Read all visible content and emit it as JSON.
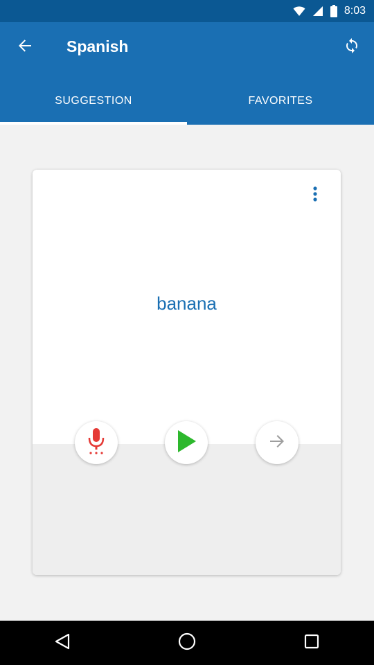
{
  "status_bar": {
    "time": "8:03"
  },
  "app_bar": {
    "title": "Spanish",
    "back_icon": "arrow-back-icon",
    "refresh_icon": "refresh-icon"
  },
  "tabs": [
    {
      "label": "SUGGESTION",
      "active": true
    },
    {
      "label": "FAVORITES",
      "active": false
    }
  ],
  "card": {
    "word": "banana",
    "menu_icon": "more-vert-icon",
    "actions": [
      {
        "name": "microphone",
        "icon": "mic-icon",
        "color": "#e53935"
      },
      {
        "name": "play",
        "icon": "play-icon",
        "color": "#2db82d"
      },
      {
        "name": "next",
        "icon": "arrow-forward-icon",
        "color": "#9e9e9e"
      }
    ]
  },
  "colors": {
    "status_bar": "#0b5893",
    "app_bar": "#1a6fb3",
    "accent_text": "#1a6fb3",
    "background": "#f2f2f2"
  },
  "nav_bar": {
    "items": [
      "back-triangle-icon",
      "home-circle-icon",
      "recents-square-icon"
    ]
  }
}
